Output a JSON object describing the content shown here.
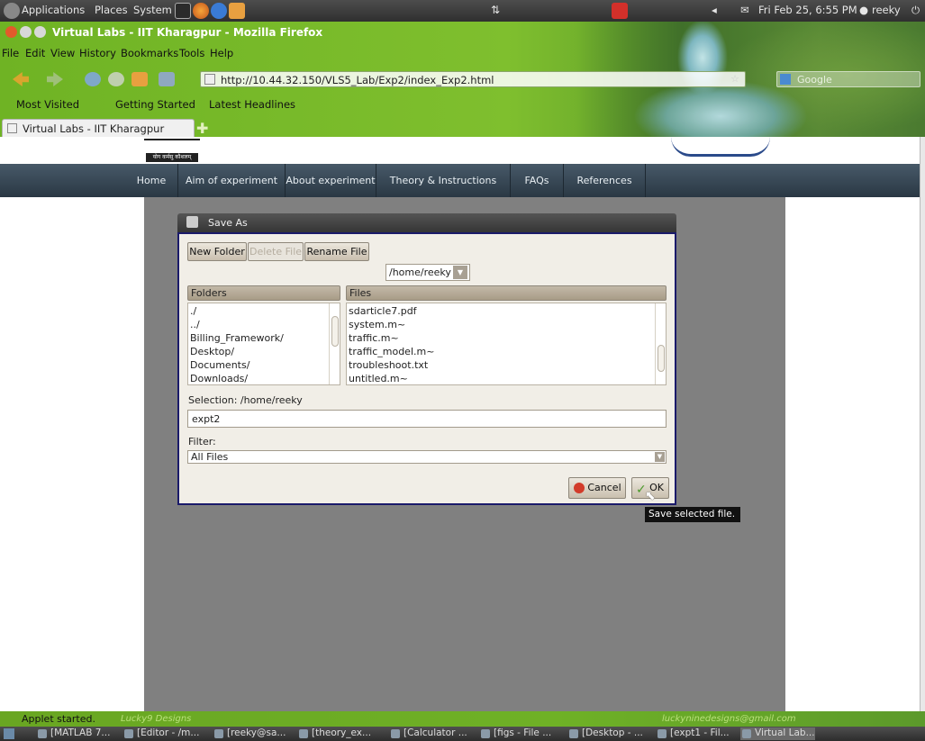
{
  "panel": {
    "menus": [
      "Applications",
      "Places",
      "System"
    ],
    "clock": "Fri Feb 25,  6:55 PM",
    "user": "reeky"
  },
  "window": {
    "title": "Virtual Labs - IIT Kharagpur - Mozilla Firefox"
  },
  "menubar": [
    "File",
    "Edit",
    "View",
    "History",
    "Bookmarks",
    "Tools",
    "Help"
  ],
  "nav": {
    "url": "http://10.44.32.150/VLS5_Lab/Exp2/index_Exp2.html",
    "search_placeholder": "Google"
  },
  "bookmarks": [
    "Most Visited",
    "Getting Started",
    "Latest Headlines"
  ],
  "tab": {
    "title": "Virtual Labs - IIT Kharagpur"
  },
  "site": {
    "logo_text": "योग कर्मसु कौशलम्",
    "menu": [
      "Home",
      "Aim of experiment",
      "About experiment",
      "Theory & Instructions",
      "FAQs",
      "References"
    ]
  },
  "dialog": {
    "title": "Save As",
    "buttons": {
      "new_folder": "New Folder",
      "delete_file": "Delete File",
      "rename_file": "Rename File",
      "cancel": "Cancel",
      "ok": "OK"
    },
    "path": "/home/reeky",
    "folders_header": "Folders",
    "files_header": "Files",
    "folders": [
      "./",
      "../",
      "Billing_Framework/",
      "Desktop/",
      "Documents/",
      "Downloads/"
    ],
    "files": [
      "sdarticle7.pdf",
      "system.m~",
      "traffic.m~",
      "traffic_model.m~",
      "troubleshoot.txt",
      "untitled.m~"
    ],
    "selection_label": "Selection: /home/reeky",
    "selection_value": "expt2",
    "filter_label": "Filter:",
    "filter_value": "All Files",
    "tooltip": "Save selected file."
  },
  "status": {
    "text": "Applet started.",
    "credit_left": "Lucky9 Designs",
    "credit_right": "luckyninedesigns@gmail.com"
  },
  "taskbar": [
    "[MATLAB 7...",
    "[Editor - /m...",
    "[reeky@sa...",
    "[theory_ex...",
    "[Calculator ...",
    "[figs - File ...",
    "[Desktop - ...",
    "[expt1 - Fil...",
    "Virtual Lab..."
  ],
  "colors": {
    "chrome_green": "#6fb324",
    "nav_bar": "#3a4a57",
    "dialog_border": "#1a1a6a"
  }
}
